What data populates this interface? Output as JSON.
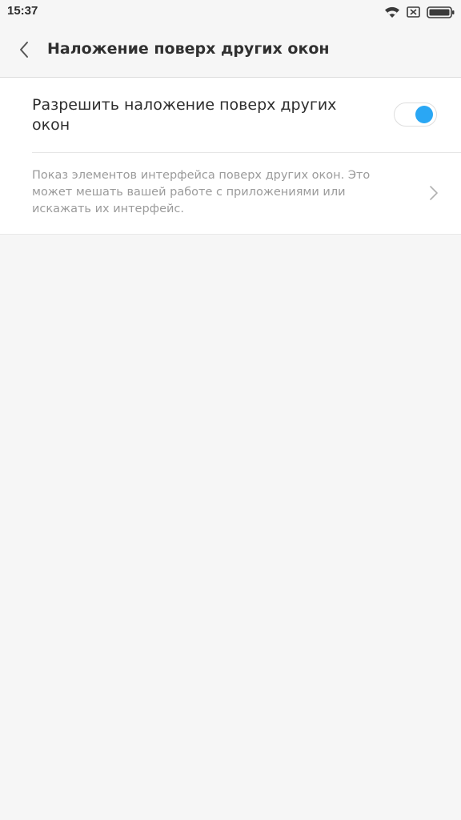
{
  "status_bar": {
    "time": "15:37",
    "icons": [
      "wifi-icon",
      "sim-blocked-icon",
      "battery-icon"
    ]
  },
  "header": {
    "back_icon": "chevron-left-icon",
    "title": "Наложение поверх других окон"
  },
  "settings": {
    "overlay_toggle": {
      "label": "Разрешить наложение поверх других окон",
      "enabled": true,
      "accent_color": "#2aa7f4"
    },
    "description": {
      "text": "Показ элементов интерфейса поверх других окон. Это может мешать вашей работе с приложениями или искажать их интерфейс.",
      "icon": "chevron-right-icon"
    }
  }
}
